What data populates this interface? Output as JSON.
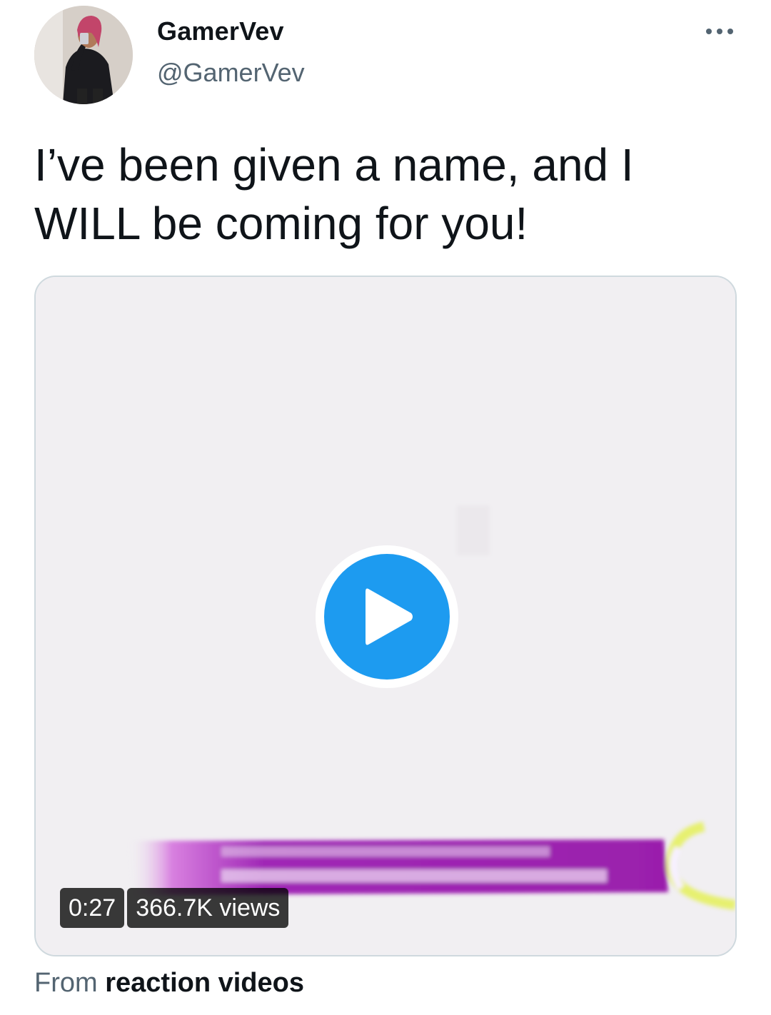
{
  "author": {
    "display_name": "GamerVev",
    "handle": "@GamerVev"
  },
  "tweet": {
    "text": "I’ve been given a name, and I WILL be coming for you!"
  },
  "media": {
    "type": "video",
    "duration": "0:27",
    "views": "366.7K views",
    "play_icon": "play-icon",
    "accent_color": "#1d9bf0"
  },
  "source": {
    "prefix": "From",
    "name": "reaction videos"
  },
  "icons": {
    "more": "more-horizontal-icon"
  }
}
